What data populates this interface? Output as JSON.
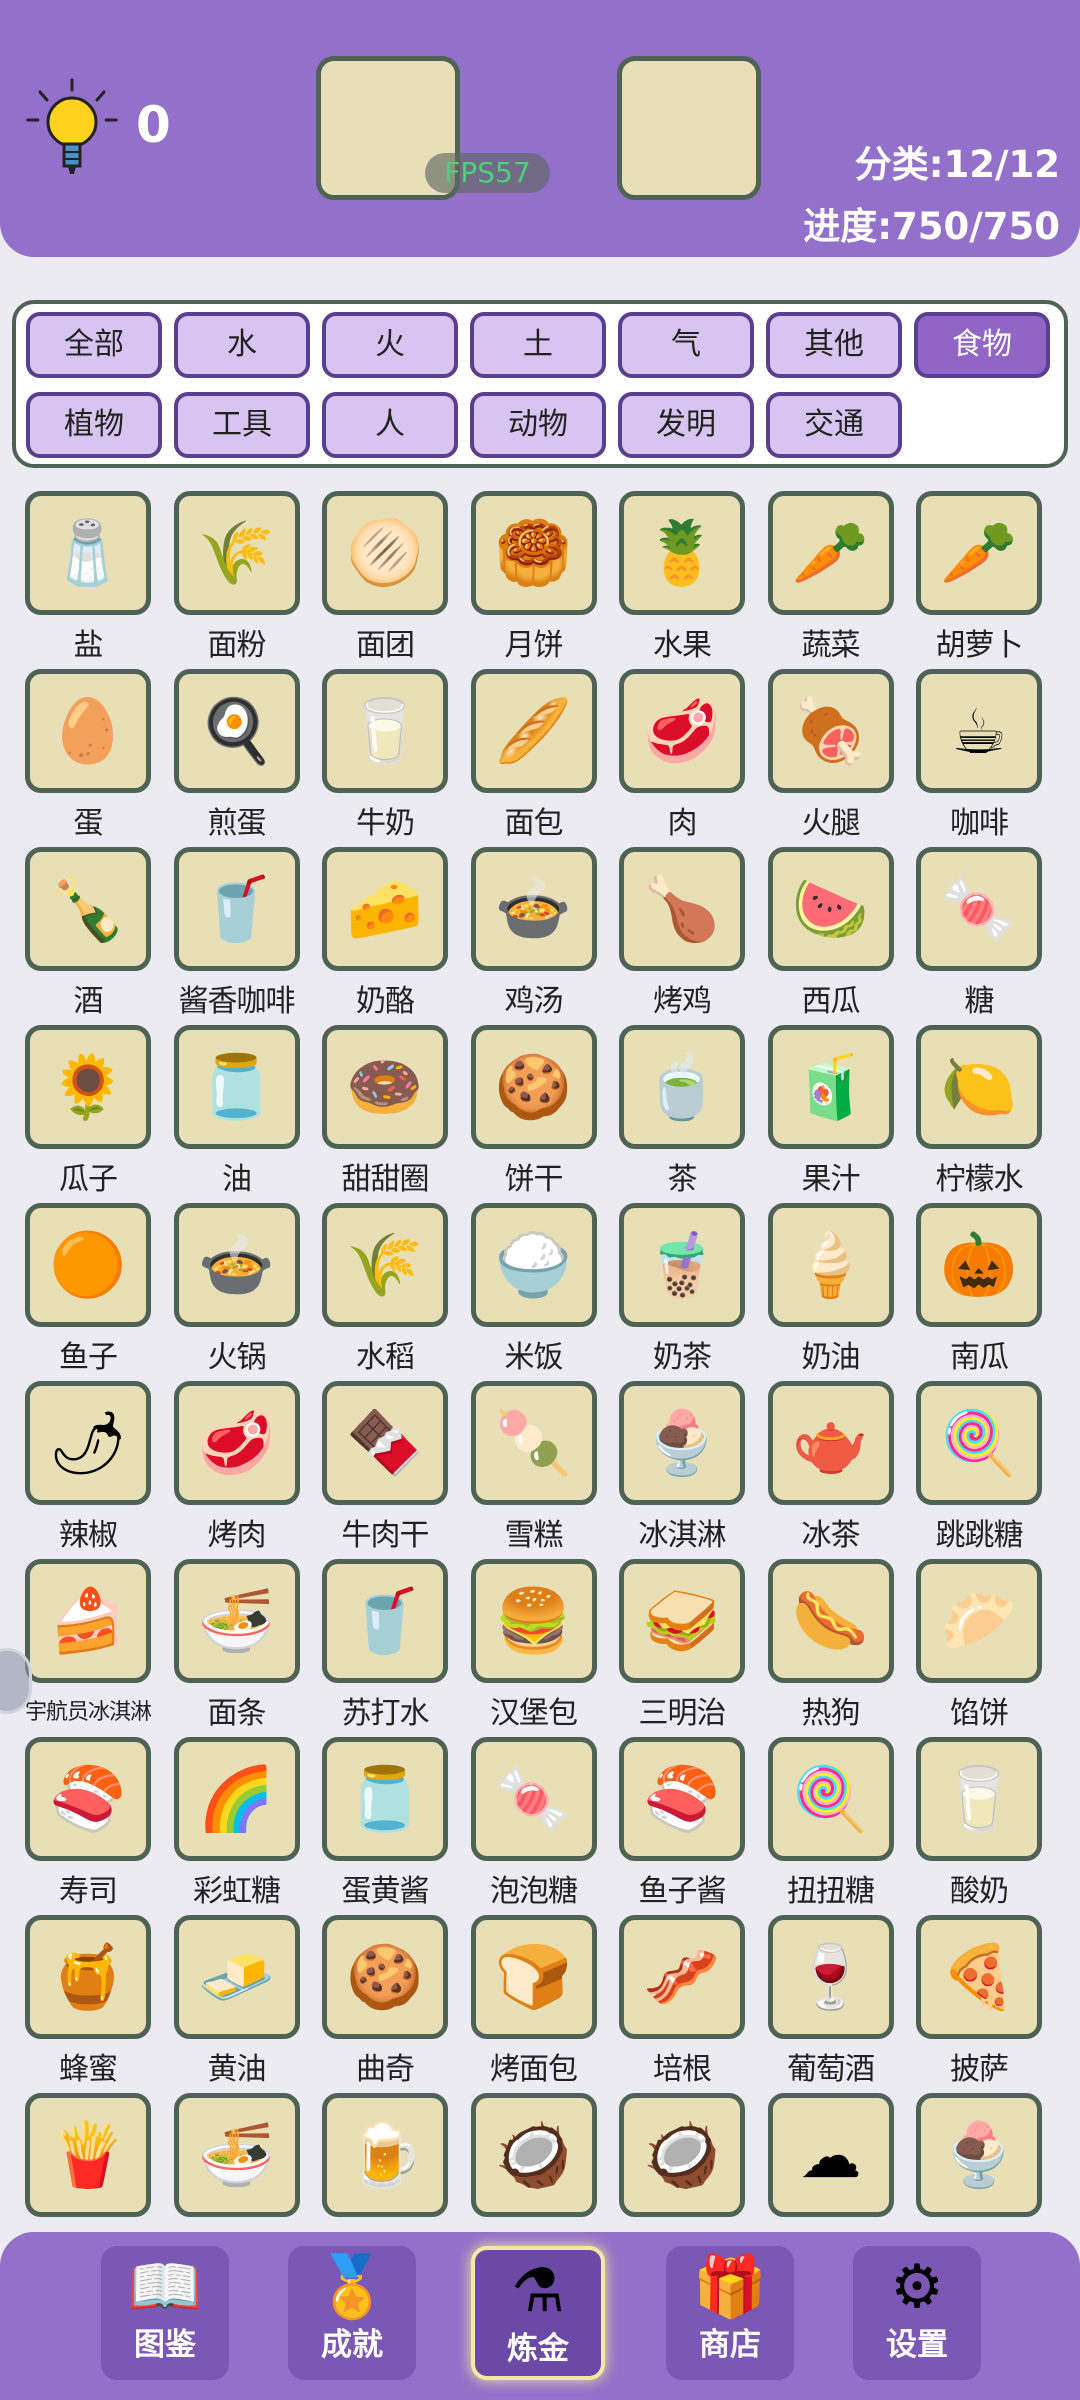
{
  "header": {
    "hint_count": "0",
    "fps": "FPS57",
    "category_progress": "分类:12/12",
    "progress": "进度:750/750"
  },
  "categories": [
    {
      "label": "全部",
      "active": false
    },
    {
      "label": "水",
      "active": false
    },
    {
      "label": "火",
      "active": false
    },
    {
      "label": "土",
      "active": false
    },
    {
      "label": "气",
      "active": false
    },
    {
      "label": "其他",
      "active": false
    },
    {
      "label": "食物",
      "active": true
    },
    {
      "label": "植物",
      "active": false
    },
    {
      "label": "工具",
      "active": false
    },
    {
      "label": "人",
      "active": false
    },
    {
      "label": "动物",
      "active": false
    },
    {
      "label": "发明",
      "active": false
    },
    {
      "label": "交通",
      "active": false
    }
  ],
  "items": [
    {
      "label": "盐",
      "icon": "salt-shaker-icon",
      "glyph": "🧂"
    },
    {
      "label": "面粉",
      "icon": "flour-sack-icon",
      "glyph": "🌾"
    },
    {
      "label": "面团",
      "icon": "dough-icon",
      "glyph": "🫓"
    },
    {
      "label": "月饼",
      "icon": "mooncake-icon",
      "glyph": "🥮"
    },
    {
      "label": "水果",
      "icon": "pineapple-icon",
      "glyph": "🍍"
    },
    {
      "label": "蔬菜",
      "icon": "cornucopia-icon",
      "glyph": "🥕"
    },
    {
      "label": "胡萝卜",
      "icon": "carrot-icon",
      "glyph": "🥕"
    },
    {
      "label": "蛋",
      "icon": "egg-icon",
      "glyph": "🥚"
    },
    {
      "label": "煎蛋",
      "icon": "fried-egg-icon",
      "glyph": "🍳"
    },
    {
      "label": "牛奶",
      "icon": "milk-bottle-icon",
      "glyph": "🥛"
    },
    {
      "label": "面包",
      "icon": "bread-icon",
      "glyph": "🥖"
    },
    {
      "label": "肉",
      "icon": "meat-icon",
      "glyph": "🥩"
    },
    {
      "label": "火腿",
      "icon": "ham-icon",
      "glyph": "🍖"
    },
    {
      "label": "咖啡",
      "icon": "coffee-cup-icon",
      "glyph": "☕"
    },
    {
      "label": "酒",
      "icon": "wine-bottle-icon",
      "glyph": "🍾"
    },
    {
      "label": "酱香咖啡",
      "icon": "coffee-to-go-icon",
      "glyph": "🥤"
    },
    {
      "label": "奶酪",
      "icon": "cheese-icon",
      "glyph": "🧀"
    },
    {
      "label": "鸡汤",
      "icon": "soup-bowl-icon",
      "glyph": "🍲"
    },
    {
      "label": "烤鸡",
      "icon": "roast-chicken-icon",
      "glyph": "🍗"
    },
    {
      "label": "西瓜",
      "icon": "watermelon-icon",
      "glyph": "🍉"
    },
    {
      "label": "糖",
      "icon": "sugar-bowl-icon",
      "glyph": "🍬"
    },
    {
      "label": "瓜子",
      "icon": "sunflower-seeds-icon",
      "glyph": "🌻"
    },
    {
      "label": "油",
      "icon": "oil-bottle-icon",
      "glyph": "🫙"
    },
    {
      "label": "甜甜圈",
      "icon": "donut-icon",
      "glyph": "🍩"
    },
    {
      "label": "饼干",
      "icon": "cookie-icon",
      "glyph": "🍪"
    },
    {
      "label": "茶",
      "icon": "tea-mug-icon",
      "glyph": "🍵"
    },
    {
      "label": "果汁",
      "icon": "juice-glass-icon",
      "glyph": "🧃"
    },
    {
      "label": "柠檬水",
      "icon": "lemonade-icon",
      "glyph": "🍋"
    },
    {
      "label": "鱼子",
      "icon": "roe-icon",
      "glyph": "🟠"
    },
    {
      "label": "火锅",
      "icon": "hotpot-icon",
      "glyph": "🍲"
    },
    {
      "label": "水稻",
      "icon": "rice-plant-icon",
      "glyph": "🌾"
    },
    {
      "label": "米饭",
      "icon": "rice-bowl-icon",
      "glyph": "🍚"
    },
    {
      "label": "奶茶",
      "icon": "bubble-tea-icon",
      "glyph": "🧋"
    },
    {
      "label": "奶油",
      "icon": "cream-piping-bag-icon",
      "glyph": "🍦"
    },
    {
      "label": "南瓜",
      "icon": "pumpkin-icon",
      "glyph": "🎃"
    },
    {
      "label": "辣椒",
      "icon": "chili-pepper-icon",
      "glyph": "🌶"
    },
    {
      "label": "烤肉",
      "icon": "grilled-steak-icon",
      "glyph": "🥩"
    },
    {
      "label": "牛肉干",
      "icon": "beef-jerky-icon",
      "glyph": "🍫"
    },
    {
      "label": "雪糕",
      "icon": "popsicle-icon",
      "glyph": "🍡"
    },
    {
      "label": "冰淇淋",
      "icon": "ice-cream-cone-icon",
      "glyph": "🍨"
    },
    {
      "label": "冰茶",
      "icon": "iced-tea-pitcher-icon",
      "glyph": "🫖"
    },
    {
      "label": "跳跳糖",
      "icon": "pop-rocks-icon",
      "glyph": "🍭"
    },
    {
      "label": "宇航员冰淇淋",
      "icon": "astronaut-ice-cream-icon",
      "glyph": "🍰"
    },
    {
      "label": "面条",
      "icon": "noodles-icon",
      "glyph": "🍜"
    },
    {
      "label": "苏打水",
      "icon": "soda-cup-icon",
      "glyph": "🥤"
    },
    {
      "label": "汉堡包",
      "icon": "hamburger-icon",
      "glyph": "🍔"
    },
    {
      "label": "三明治",
      "icon": "sandwich-icon",
      "glyph": "🥪"
    },
    {
      "label": "热狗",
      "icon": "hot-dog-icon",
      "glyph": "🌭"
    },
    {
      "label": "馅饼",
      "icon": "pie-icon",
      "glyph": "🥟"
    },
    {
      "label": "寿司",
      "icon": "sushi-icon",
      "glyph": "🍣"
    },
    {
      "label": "彩虹糖",
      "icon": "rainbow-candy-icon",
      "glyph": "🌈"
    },
    {
      "label": "蛋黄酱",
      "icon": "mayonnaise-jar-icon",
      "glyph": "🫙"
    },
    {
      "label": "泡泡糖",
      "icon": "bubble-gum-icon",
      "glyph": "🍬"
    },
    {
      "label": "鱼子酱",
      "icon": "caviar-icon",
      "glyph": "🍣"
    },
    {
      "label": "扭扭糖",
      "icon": "twist-candy-icon",
      "glyph": "🍭"
    },
    {
      "label": "酸奶",
      "icon": "yogurt-icon",
      "glyph": "🥛"
    },
    {
      "label": "蜂蜜",
      "icon": "honey-dipper-icon",
      "glyph": "🍯"
    },
    {
      "label": "黄油",
      "icon": "butter-icon",
      "glyph": "🧈"
    },
    {
      "label": "曲奇",
      "icon": "cookie-icon",
      "glyph": "🍪"
    },
    {
      "label": "烤面包",
      "icon": "toast-icon",
      "glyph": "🍞"
    },
    {
      "label": "培根",
      "icon": "bacon-icon",
      "glyph": "🥓"
    },
    {
      "label": "葡萄酒",
      "icon": "wine-bottle-icon",
      "glyph": "🍷"
    },
    {
      "label": "披萨",
      "icon": "pizza-icon",
      "glyph": "🍕"
    },
    {
      "label": "",
      "icon": "snack-bag-icon",
      "glyph": "🍟"
    },
    {
      "label": "",
      "icon": "ramen-bowl-icon",
      "glyph": "🍜"
    },
    {
      "label": "",
      "icon": "beer-mug-icon",
      "glyph": "🍺"
    },
    {
      "label": "",
      "icon": "coconut-icon",
      "glyph": "🥥"
    },
    {
      "label": "",
      "icon": "coconut-drink-icon",
      "glyph": "🥥"
    },
    {
      "label": "",
      "icon": "cotton-candy-icon",
      "glyph": "☁"
    },
    {
      "label": "",
      "icon": "ice-cream-cup-icon",
      "glyph": "🍨"
    }
  ],
  "nav": [
    {
      "label": "图鉴",
      "icon": "book-icon",
      "glyph": "📖",
      "active": false
    },
    {
      "label": "成就",
      "icon": "medal-icon",
      "glyph": "🏅",
      "active": false
    },
    {
      "label": "炼金",
      "icon": "flask-icon",
      "glyph": "⚗",
      "active": true
    },
    {
      "label": "商店",
      "icon": "gift-box-icon",
      "glyph": "🎁",
      "active": false
    },
    {
      "label": "设置",
      "icon": "gear-icon",
      "glyph": "⚙",
      "active": false
    }
  ],
  "colors": {
    "primary_purple": "#9370c9",
    "tile_bg": "#e9dfb6",
    "tile_border": "#4f6355",
    "category_bg": "#d8c4f1",
    "category_active": "#9065c6"
  }
}
